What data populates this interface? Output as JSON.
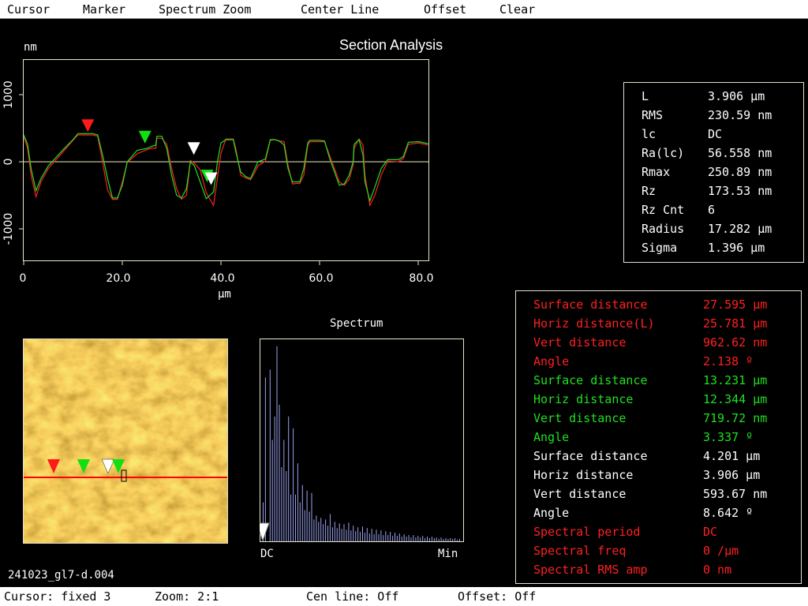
{
  "menu": {
    "items": [
      {
        "label": "Cursor"
      },
      {
        "label": "Marker"
      },
      {
        "label": "Spectrum Zoom"
      },
      {
        "label": "Center Line"
      },
      {
        "label": "Offset"
      },
      {
        "label": "Clear"
      }
    ]
  },
  "section": {
    "title": "Section Analysis",
    "y_unit": "nm",
    "x_unit": "µm",
    "y_ticks": [
      "1000",
      "0",
      "-1000"
    ],
    "x_ticks": [
      "0",
      "20.0",
      "40.0",
      "60.0",
      "80.0"
    ]
  },
  "chart_data": [
    {
      "type": "line",
      "title": "Section Analysis",
      "xlabel": "µm",
      "ylabel": "nm",
      "xlim": [
        0,
        82
      ],
      "ylim": [
        -1500,
        1500
      ],
      "series": [
        {
          "color": "#ff2020",
          "points": [
            [
              0,
              380
            ],
            [
              0.8,
              200
            ],
            [
              1.5,
              -200
            ],
            [
              2.5,
              -520
            ],
            [
              3.5,
              -300
            ],
            [
              5,
              -100
            ],
            [
              8,
              150
            ],
            [
              10,
              320
            ],
            [
              11,
              400
            ],
            [
              14,
              400
            ],
            [
              15,
              380
            ],
            [
              16,
              0
            ],
            [
              17,
              -420
            ],
            [
              18,
              -560
            ],
            [
              19,
              -560
            ],
            [
              20,
              -300
            ],
            [
              21,
              -10
            ],
            [
              23,
              120
            ],
            [
              25,
              180
            ],
            [
              26,
              200
            ],
            [
              26.8,
              200
            ],
            [
              27,
              350
            ],
            [
              28,
              350
            ],
            [
              29,
              260
            ],
            [
              30,
              -100
            ],
            [
              31,
              -400
            ],
            [
              32,
              -560
            ],
            [
              33,
              -500
            ],
            [
              33.8,
              20
            ],
            [
              34.6,
              -20
            ],
            [
              35.8,
              -120
            ],
            [
              37,
              -460
            ],
            [
              38.5,
              -650
            ],
            [
              39.3,
              -240
            ],
            [
              40,
              130
            ],
            [
              41,
              340
            ],
            [
              42.5,
              340
            ],
            [
              43,
              200
            ],
            [
              44,
              -200
            ],
            [
              45,
              -240
            ],
            [
              46,
              -270
            ],
            [
              46.8,
              -170
            ],
            [
              47.5,
              -60
            ],
            [
              49,
              10
            ],
            [
              50,
              320
            ],
            [
              51,
              330
            ],
            [
              52,
              310
            ],
            [
              52.8,
              300
            ],
            [
              53.6,
              -50
            ],
            [
              54.5,
              -330
            ],
            [
              56,
              -320
            ],
            [
              56.8,
              -200
            ],
            [
              57.6,
              240
            ],
            [
              58,
              300
            ],
            [
              60,
              300
            ],
            [
              61,
              300
            ],
            [
              62,
              100
            ],
            [
              63,
              -100
            ],
            [
              64,
              -300
            ],
            [
              65,
              -350
            ],
            [
              66,
              -260
            ],
            [
              66.8,
              -50
            ],
            [
              67,
              200
            ],
            [
              68,
              340
            ],
            [
              68.8,
              250
            ],
            [
              69.2,
              -200
            ],
            [
              70.2,
              -650
            ],
            [
              71.2,
              -500
            ],
            [
              72.5,
              -200
            ],
            [
              73.8,
              10
            ],
            [
              76,
              0
            ],
            [
              77,
              50
            ],
            [
              78,
              260
            ],
            [
              80,
              280
            ],
            [
              82,
              250
            ]
          ]
        },
        {
          "color": "#20e020",
          "points": [
            [
              0,
              400
            ],
            [
              0.8,
              260
            ],
            [
              1.5,
              -100
            ],
            [
              2.5,
              -430
            ],
            [
              3.5,
              -250
            ],
            [
              5,
              -60
            ],
            [
              8,
              180
            ],
            [
              10,
              330
            ],
            [
              11,
              420
            ],
            [
              14,
              420
            ],
            [
              15,
              400
            ],
            [
              16,
              100
            ],
            [
              17,
              -250
            ],
            [
              18,
              -540
            ],
            [
              19,
              -540
            ],
            [
              20,
              -350
            ],
            [
              21,
              0
            ],
            [
              23,
              170
            ],
            [
              25,
              200
            ],
            [
              26,
              230
            ],
            [
              26.8,
              250
            ],
            [
              27,
              380
            ],
            [
              28,
              380
            ],
            [
              29,
              200
            ],
            [
              30,
              -200
            ],
            [
              31,
              -500
            ],
            [
              32,
              -540
            ],
            [
              33,
              -400
            ],
            [
              33.8,
              0
            ],
            [
              34.6,
              -60
            ],
            [
              35.8,
              -300
            ],
            [
              37,
              -550
            ],
            [
              38.5,
              -450
            ],
            [
              39.3,
              0
            ],
            [
              40,
              280
            ],
            [
              41,
              330
            ],
            [
              42.5,
              330
            ],
            [
              43,
              150
            ],
            [
              44,
              -150
            ],
            [
              45,
              -220
            ],
            [
              46,
              -250
            ],
            [
              46.8,
              -120
            ],
            [
              47.5,
              0
            ],
            [
              49,
              40
            ],
            [
              50,
              330
            ],
            [
              51,
              330
            ],
            [
              52,
              300
            ],
            [
              52.8,
              250
            ],
            [
              53.6,
              -100
            ],
            [
              54.5,
              -300
            ],
            [
              56,
              -300
            ],
            [
              56.8,
              -100
            ],
            [
              57.6,
              280
            ],
            [
              58,
              320
            ],
            [
              60,
              320
            ],
            [
              61,
              310
            ],
            [
              62,
              60
            ],
            [
              63,
              -150
            ],
            [
              64,
              -350
            ],
            [
              65,
              -330
            ],
            [
              66,
              -200
            ],
            [
              66.8,
              0
            ],
            [
              67,
              260
            ],
            [
              68,
              330
            ],
            [
              68.8,
              100
            ],
            [
              69.2,
              -300
            ],
            [
              70.2,
              -580
            ],
            [
              71.2,
              -380
            ],
            [
              72.5,
              -100
            ],
            [
              73.8,
              30
            ],
            [
              76,
              30
            ],
            [
              77,
              80
            ],
            [
              78,
              290
            ],
            [
              80,
              300
            ],
            [
              82,
              270
            ]
          ]
        }
      ],
      "center_line": 0,
      "markers": [
        {
          "x": 13,
          "y": 420,
          "color": "red"
        },
        {
          "x": 24.6,
          "y": 250,
          "color": "green"
        },
        {
          "x": 34.5,
          "y": 80,
          "color": "white"
        },
        {
          "x": 37.2,
          "y": -330,
          "color": "green"
        },
        {
          "x": 38,
          "y": -370,
          "color": "white"
        }
      ]
    },
    {
      "type": "bar",
      "title": "Spectrum",
      "xlabel_left": "DC",
      "xlabel_right": "Min",
      "values": [
        50,
        210,
        0,
        220,
        130,
        160,
        250,
        175,
        95,
        130,
        90,
        160,
        60,
        145,
        60,
        100,
        50,
        72,
        40,
        65,
        38,
        62,
        28,
        33,
        25,
        30,
        22,
        28,
        20,
        35,
        18,
        25,
        17,
        23,
        16,
        22,
        15,
        24,
        14,
        20,
        13,
        18,
        12,
        19,
        11,
        17,
        10,
        16,
        9,
        15,
        9,
        14,
        8,
        13,
        8,
        12,
        7,
        11,
        7,
        10,
        6,
        9,
        6,
        8,
        5,
        8,
        5,
        7,
        5,
        7,
        4,
        6,
        4,
        6,
        4,
        5,
        3,
        5,
        3,
        4,
        3,
        4,
        3,
        4,
        2,
        3
      ],
      "ylim": [
        0,
        260
      ],
      "cursor_index": 0
    }
  ],
  "stats": {
    "rows": [
      {
        "label": "L",
        "value": "3.906 µm"
      },
      {
        "label": "RMS",
        "value": "230.59 nm"
      },
      {
        "label": "lc",
        "value": "DC"
      },
      {
        "label": "Ra(lc)",
        "value": "56.558 nm"
      },
      {
        "label": "Rmax",
        "value": "250.89 nm"
      },
      {
        "label": "Rz",
        "value": "173.53 nm"
      },
      {
        "label": "Rz Cnt",
        "value": "6"
      },
      {
        "label": "Radius",
        "value": "17.282 µm"
      },
      {
        "label": "Sigma",
        "value": "1.396 µm"
      }
    ]
  },
  "measurements": {
    "rows": [
      {
        "label": "Surface distance",
        "value": "27.595 µm",
        "color": "#ff2020"
      },
      {
        "label": "Horiz distance(L)",
        "value": "25.781 µm",
        "color": "#ff2020"
      },
      {
        "label": "Vert distance",
        "value": "962.62 nm",
        "color": "#ff2020"
      },
      {
        "label": "Angle",
        "value": "2.138 º",
        "color": "#ff2020"
      },
      {
        "label": "Surface distance",
        "value": "13.231 µm",
        "color": "#20e020"
      },
      {
        "label": "Horiz distance",
        "value": "12.344 µm",
        "color": "#20e020"
      },
      {
        "label": "Vert distance",
        "value": "719.72 nm",
        "color": "#20e020"
      },
      {
        "label": "Angle",
        "value": "3.337 º",
        "color": "#20e020"
      },
      {
        "label": "Surface distance",
        "value": "4.201 µm",
        "color": "#ffffff"
      },
      {
        "label": "Horiz distance",
        "value": "3.906 µm",
        "color": "#ffffff"
      },
      {
        "label": "Vert distance",
        "value": "593.67 nm",
        "color": "#ffffff"
      },
      {
        "label": "Angle",
        "value": "8.642 º",
        "color": "#ffffff"
      },
      {
        "label": "Spectral period",
        "value": "DC",
        "color": "#ff2020"
      },
      {
        "label": "Spectral freq",
        "value": "0 /µm",
        "color": "#ff2020"
      },
      {
        "label": "Spectral RMS amp",
        "value": "0 nm",
        "color": "#ff2020"
      }
    ]
  },
  "image": {
    "filename": "241023_gl7-d.004",
    "section_line_color": "#ff0000",
    "markers": [
      {
        "color": "red"
      },
      {
        "color": "green"
      },
      {
        "color": "white"
      },
      {
        "color": "green"
      }
    ]
  },
  "status": {
    "cursor": "Cursor: fixed 3",
    "zoom": "Zoom: 2:1",
    "cen_line": "Cen line: Off",
    "offset": "Offset: Off"
  }
}
